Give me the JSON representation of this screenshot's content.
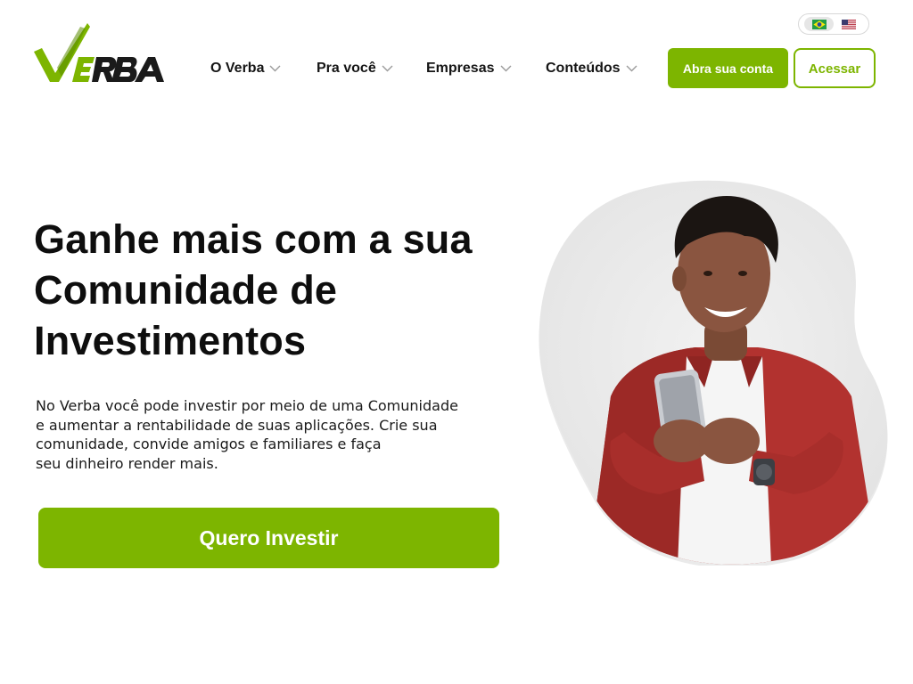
{
  "logo": {
    "text": "VERBA",
    "brand_green": "#7db500",
    "dark": "#1a1a1a"
  },
  "language_switch": [
    {
      "code": "pt-BR",
      "icon": "brazil-flag-icon",
      "active": true
    },
    {
      "code": "en-US",
      "icon": "usa-flag-icon",
      "active": false
    }
  ],
  "nav": {
    "items": [
      {
        "label": "O Verba",
        "icon": "chevron-down-icon"
      },
      {
        "label": "Pra você",
        "icon": "chevron-down-icon"
      },
      {
        "label": "Empresas",
        "icon": "chevron-down-icon"
      },
      {
        "label": "Conteúdos",
        "icon": "chevron-down-icon"
      }
    ],
    "open_account_label": "Abra sua conta",
    "login_label": "Acessar"
  },
  "hero": {
    "title_lines": [
      "Ganhe mais com a sua",
      "Comunidade de",
      "Investimentos"
    ],
    "description_lines": [
      "No Verba você pode investir por meio de uma  Comunidade",
      "e aumentar a rentabilidade de suas aplicações. Crie sua",
      "comunidade, convide amigos e familiares e faça",
      "seu dinheiro render mais."
    ],
    "cta_label": "Quero Investir",
    "image": "smiling-man-with-phone"
  },
  "colors": {
    "accent": "#7db500",
    "text": "#111111"
  }
}
